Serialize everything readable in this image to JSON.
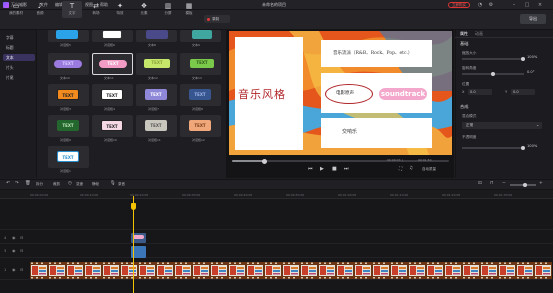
{
  "app": {
    "name": "万兴喵影",
    "title": "未命名的项目",
    "upgrade_label": "立即购买"
  },
  "menus": [
    "文件",
    "编辑",
    "导出",
    "视图",
    "帮助"
  ],
  "toolbar": {
    "items": [
      {
        "label": "我的素材",
        "icon": "folder-icon"
      },
      {
        "label": "音频",
        "icon": "music-icon"
      },
      {
        "label": "文字",
        "icon": "text-icon",
        "active": true
      },
      {
        "label": "转场",
        "icon": "transition-icon"
      },
      {
        "label": "特效",
        "icon": "effects-icon"
      },
      {
        "label": "元素",
        "icon": "elements-icon"
      },
      {
        "label": "分屏",
        "icon": "split-screen-icon"
      },
      {
        "label": "模板",
        "icon": "template-icon"
      }
    ],
    "mode_label": "录制",
    "export_label": "导出"
  },
  "categories": [
    "字幕",
    "标题",
    "文本",
    "片头",
    "片尾"
  ],
  "selected_category": 2,
  "grid": {
    "tiles": [
      {
        "label": "对话框5",
        "text": "",
        "style": "bubble-blue"
      },
      {
        "label": "对话框6",
        "text": "",
        "style": "bubble-white"
      },
      {
        "label": "文本8",
        "text": "",
        "style": "bubble-dark"
      },
      {
        "label": "文本9",
        "text": "",
        "style": "bubble-teal"
      },
      {
        "label": "文本10",
        "text": "TEXT",
        "style": "pill-purple"
      },
      {
        "label": "文本11",
        "text": "TEXT",
        "style": "pill-pink"
      },
      {
        "label": "文本12",
        "text": "TEXT",
        "style": "bubble-lime"
      },
      {
        "label": "文本13",
        "text": "TEXT",
        "style": "bubble-green"
      },
      {
        "label": "对话框3",
        "text": "TEXT",
        "style": "bubble-orange"
      },
      {
        "label": "对话框4",
        "text": "TEXT",
        "style": "bubble-white"
      },
      {
        "label": "对话框7",
        "text": "TEXT",
        "style": "bubble-lilac"
      },
      {
        "label": "对话框8",
        "text": "TEXT",
        "style": "bubble-navy"
      },
      {
        "label": "对话框9",
        "text": "TEXT",
        "style": "bubble-forest"
      },
      {
        "label": "对话框10",
        "text": "TEXT",
        "style": "bubble-rose"
      },
      {
        "label": "对话框11",
        "text": "TEXT",
        "style": "bubble-stone"
      },
      {
        "label": "对话框12",
        "text": "TEXT",
        "style": "bubble-peach"
      },
      {
        "label": "对话框1",
        "text": "TEXT",
        "style": "bubble-cyan"
      }
    ]
  },
  "preview": {
    "title_text": "音乐风格",
    "genres_text": "音乐流派（R&B、Rock、Pop、etc.）",
    "circle_text": "电影原声",
    "soundtrack_text": "soundtrack",
    "bottom_text": "交响乐",
    "time_current": "00:00:03",
    "time_total": "00:01:50",
    "quality_label": "自动质量"
  },
  "properties": {
    "tabs": [
      "属性",
      "动画"
    ],
    "section_basic": "基础",
    "scale_label": "缩放大小",
    "scale_value": "100%",
    "rotation_label": "旋转角度",
    "rotation_value": "0.0°",
    "position_label": "位置",
    "pos_x_label": "X",
    "pos_x_value": "0.0",
    "pos_y_label": "Y",
    "pos_y_value": "0.0",
    "section_blend": "合成",
    "blend_label": "混合模式",
    "blend_value": "正常",
    "opacity_label": "不透明度",
    "opacity_value": "100%",
    "scale_fraction": 1.0,
    "opacity_fraction": 1.0
  },
  "timeline_tools": {
    "split_label": "拆分",
    "crop_label": "裁剪",
    "speed_label": "变速",
    "freeze_label": "静帧",
    "record_label": "录音"
  },
  "ruler": [
    "00:00:00:00",
    "00:00:10:00",
    "00:00:20:00",
    "00:00:30:00",
    "00:00:40:00",
    "00:00:50:00",
    "00:01:00:00",
    "00:01:10:00",
    "00:01:20:00",
    "00:01:30:00",
    "00:01:40:00",
    "00:01:50:00"
  ],
  "tracks": [
    "4",
    "3",
    "2",
    "1"
  ],
  "colors": {
    "accent": "#7a5cff",
    "playhead": "#f5c400",
    "record": "#e0373a"
  }
}
